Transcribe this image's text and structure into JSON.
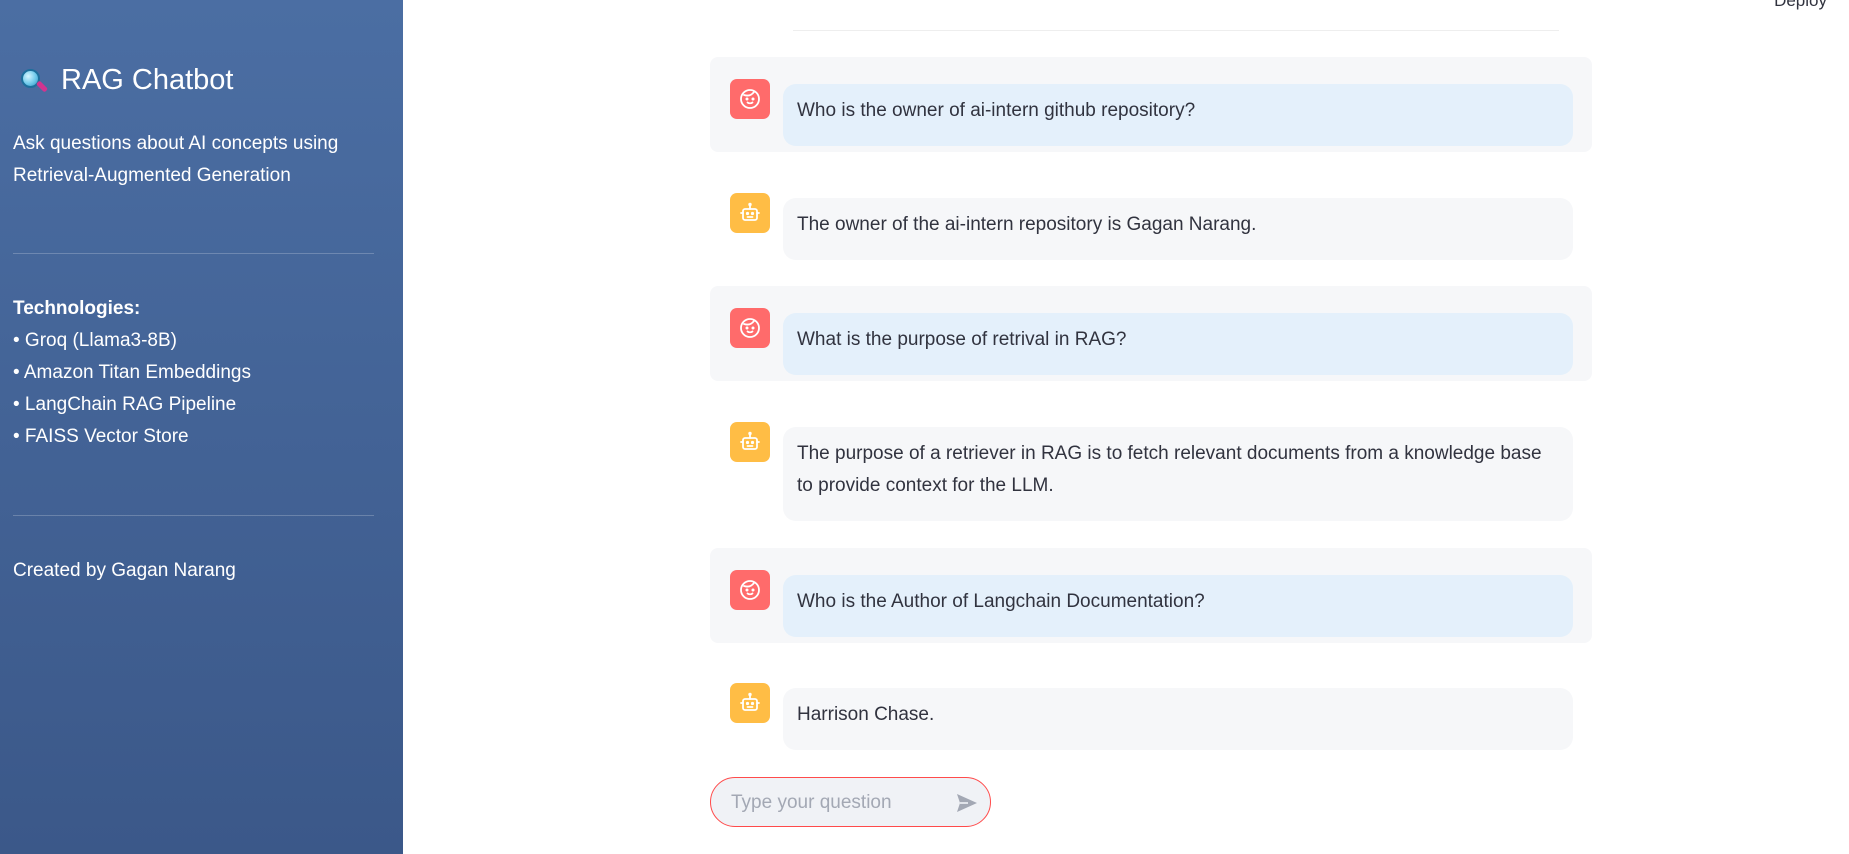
{
  "sidebar": {
    "title": "RAG Chatbot",
    "title_icon": "magnifying-glass-icon",
    "description": "Ask questions about AI concepts using Retrieval-Augmented Generation",
    "tech_heading": "Technologies:",
    "tech_items": [
      "• Groq (Llama3-8B)",
      "• Amazon Titan Embeddings",
      "• LangChain RAG Pipeline",
      "• FAISS Vector Store"
    ],
    "credit": "Created by Gagan Narang"
  },
  "header": {
    "deploy_label": "Deploy"
  },
  "messages": [
    {
      "role": "user",
      "avatar_icon": "user-face-icon",
      "text": "Who is the owner of ai-intern github repository?"
    },
    {
      "role": "assistant",
      "avatar_icon": "robot-icon",
      "text": "The owner of the ai-intern repository is Gagan Narang."
    },
    {
      "role": "user",
      "avatar_icon": "user-face-icon",
      "text": "What is the purpose of retrival in RAG?"
    },
    {
      "role": "assistant",
      "avatar_icon": "robot-icon",
      "text": "The purpose of a retriever in RAG is to fetch relevant documents from a knowledge base to provide context for the LLM."
    },
    {
      "role": "user",
      "avatar_icon": "user-face-icon",
      "text": "Who is the Author of Langchain Documentation?"
    },
    {
      "role": "assistant",
      "avatar_icon": "robot-icon",
      "text": "Harrison Chase."
    }
  ],
  "chat_input": {
    "placeholder": "Type your question",
    "value": "",
    "send_icon": "send-icon"
  },
  "colors": {
    "sidebar_top": "#4b6ea3",
    "sidebar_bottom": "#3b5889",
    "user_avatar": "#ff6b6b",
    "bot_avatar": "#ffbd45",
    "user_bubble": "#e4f0fb",
    "bot_bubble": "#f6f7f9",
    "input_border": "#ff4b4b"
  }
}
